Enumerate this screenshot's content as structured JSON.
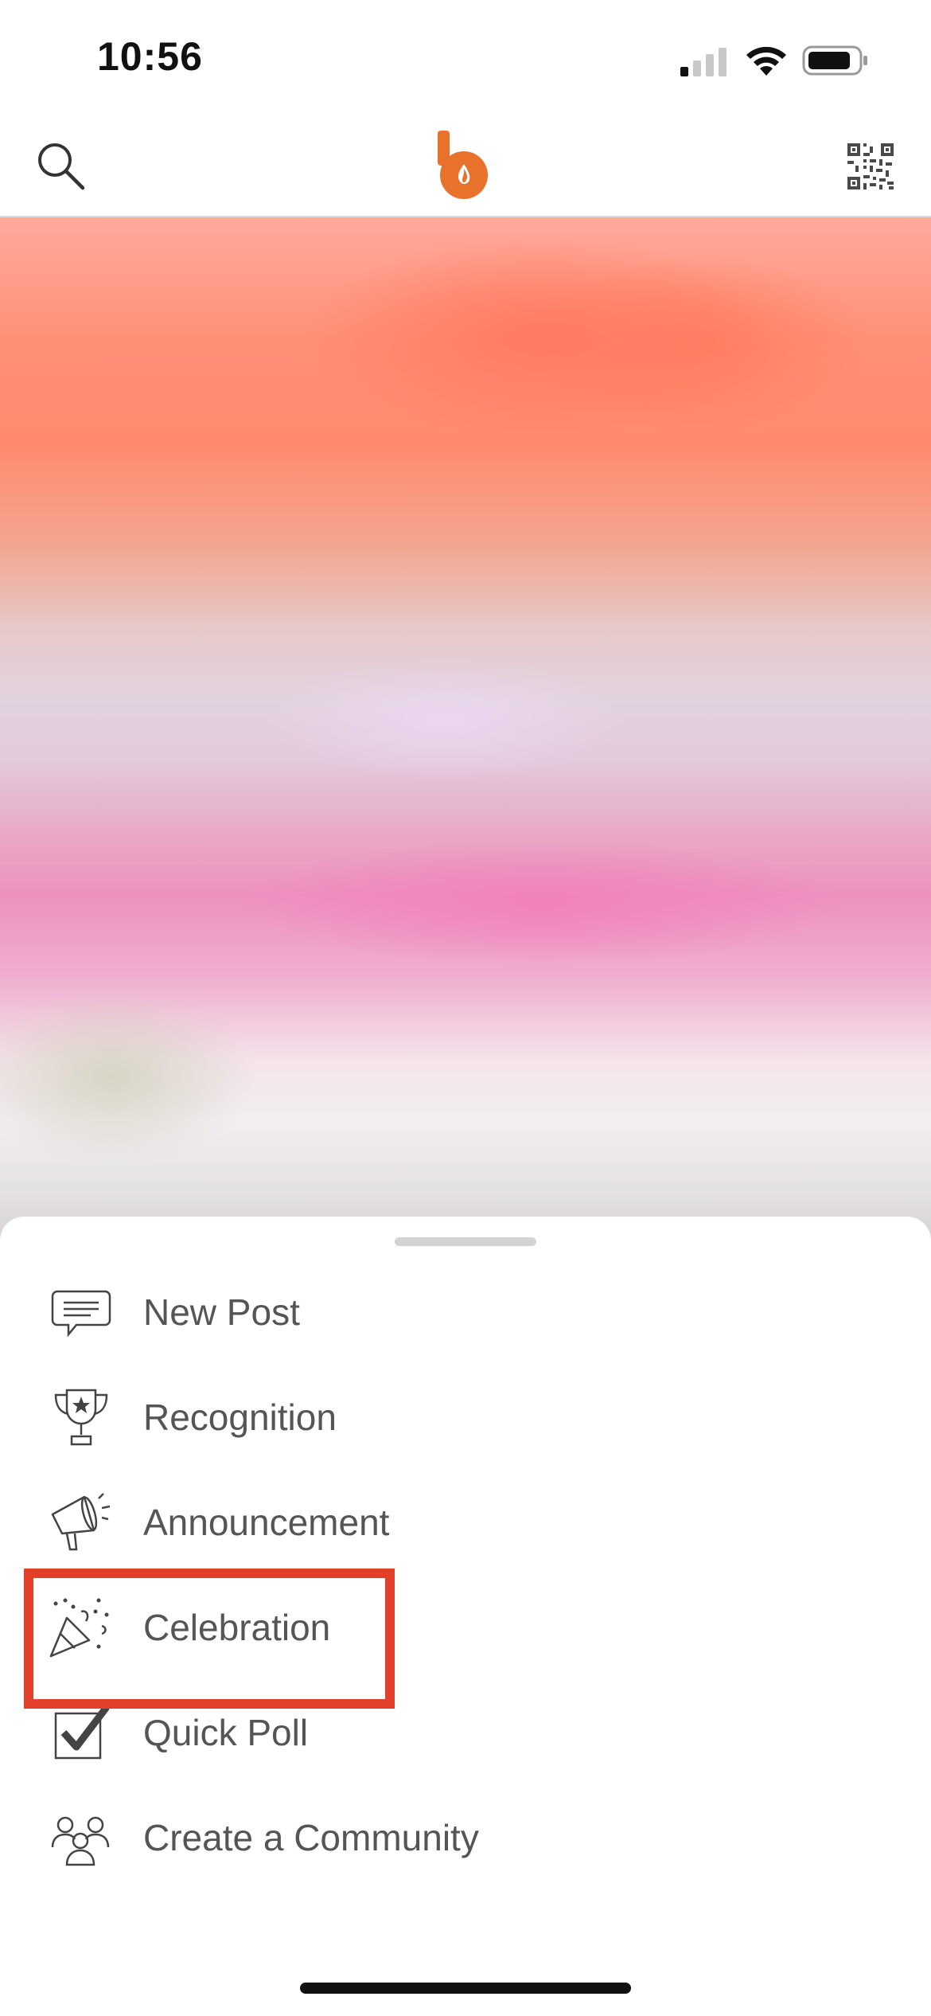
{
  "status_bar": {
    "time": "10:56"
  },
  "header": {
    "brand_color": "#e8722b",
    "search_icon": "search-icon",
    "logo_icon": "bonusly-logo",
    "qr_icon": "qr-code-icon"
  },
  "sheet": {
    "menu": [
      {
        "label": "New Post",
        "icon": "speech-bubble-icon"
      },
      {
        "label": "Recognition",
        "icon": "trophy-icon"
      },
      {
        "label": "Announcement",
        "icon": "megaphone-icon"
      },
      {
        "label": "Celebration",
        "icon": "party-popper-icon"
      },
      {
        "label": "Quick Poll",
        "icon": "checkbox-icon"
      },
      {
        "label": "Create a Community",
        "icon": "people-group-icon"
      }
    ]
  },
  "highlight": {
    "color": "#e2402b",
    "target": "Celebration"
  }
}
